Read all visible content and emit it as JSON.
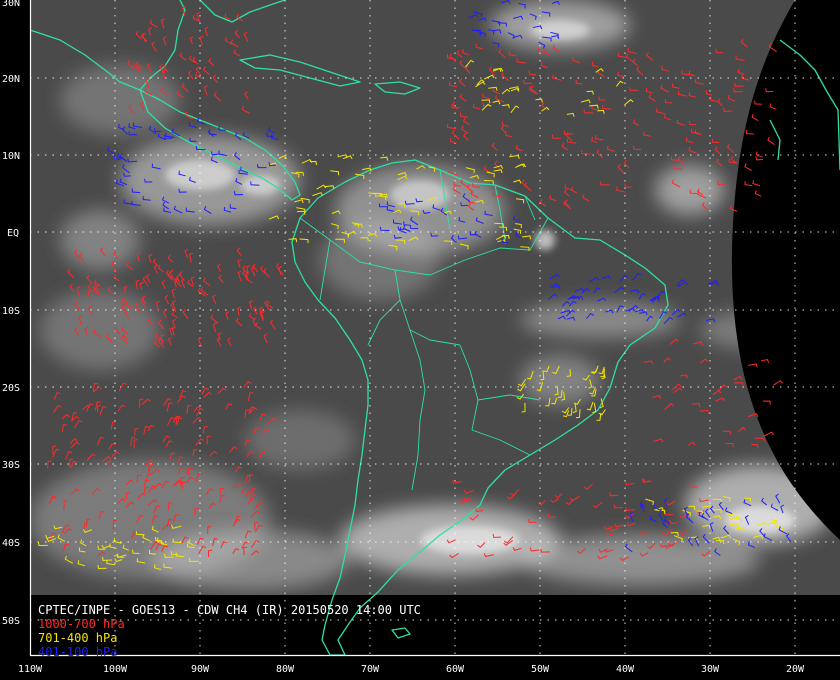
{
  "title": "CPTEC/INPE - GOES13 - CDW CH4 (IR) 20150520 14:00 UTC",
  "legend": [
    {
      "label": "1000-700 hPa",
      "color": "#ff2a2a"
    },
    {
      "label": "701-400 hPa",
      "color": "#f2e600"
    },
    {
      "label": "401-100 hPa",
      "color": "#1f1fff"
    }
  ],
  "latitude_labels": [
    "30N",
    "20N",
    "10N",
    "EQ",
    "10S",
    "20S",
    "30S",
    "40S",
    "50S"
  ],
  "longitude_labels": [
    "110W",
    "100W",
    "90W",
    "80W",
    "70W",
    "60W",
    "50W",
    "40W",
    "30W",
    "20W"
  ],
  "colors": {
    "background": "#000000",
    "coastline": "#2ee0a0",
    "grid": "#ffffff",
    "satellite_cloud": "#d8d8d8",
    "satellite_ground": "#4a4a4a"
  },
  "wind_vector_regions": [
    {
      "level": "1000-700 hPa",
      "lon_min": -105,
      "lon_max": -80,
      "lat_min": -15,
      "lat_max": -3,
      "count": 120
    },
    {
      "level": "1000-700 hPa",
      "lon_min": -108,
      "lon_max": -82,
      "lat_min": -42,
      "lat_max": -20,
      "count": 160
    },
    {
      "level": "1000-700 hPa",
      "lon_min": -60,
      "lon_max": -22,
      "lat_min": 2,
      "lat_max": 24,
      "count": 160
    },
    {
      "level": "1000-700 hPa",
      "lon_min": -98,
      "lon_max": -84,
      "lat_min": 14,
      "lat_max": 28,
      "count": 50
    },
    {
      "level": "1000-700 hPa",
      "lon_min": -60,
      "lon_max": -30,
      "lat_min": -42,
      "lat_max": -32,
      "count": 60
    },
    {
      "level": "1000-700 hPa",
      "lon_min": -38,
      "lon_max": -22,
      "lat_min": -28,
      "lat_max": -14,
      "count": 30
    },
    {
      "level": "701-400 hPa",
      "lon_min": -82,
      "lon_max": -52,
      "lat_min": -2,
      "lat_max": 10,
      "count": 70
    },
    {
      "level": "701-400 hPa",
      "lon_min": -52,
      "lon_max": -42,
      "lat_min": -24,
      "lat_max": -17,
      "count": 35
    },
    {
      "level": "701-400 hPa",
      "lon_min": -108,
      "lon_max": -90,
      "lat_min": -44,
      "lat_max": -38,
      "count": 40
    },
    {
      "level": "701-400 hPa",
      "lon_min": -38,
      "lon_max": -22,
      "lat_min": -40,
      "lat_max": -34,
      "count": 30
    },
    {
      "level": "701-400 hPa",
      "lon_min": -60,
      "lon_max": -40,
      "lat_min": 15,
      "lat_max": 22,
      "count": 25
    },
    {
      "level": "401-100 hPa",
      "lon_min": -100,
      "lon_max": -80,
      "lat_min": 2,
      "lat_max": 14,
      "count": 60
    },
    {
      "level": "401-100 hPa",
      "lon_min": -50,
      "lon_max": -30,
      "lat_min": -12,
      "lat_max": -6,
      "count": 45
    },
    {
      "level": "401-100 hPa",
      "lon_min": -40,
      "lon_max": -20,
      "lat_min": -42,
      "lat_max": -35,
      "count": 35
    },
    {
      "level": "401-100 hPa",
      "lon_min": -60,
      "lon_max": -48,
      "lat_min": 24,
      "lat_max": 30,
      "count": 25
    },
    {
      "level": "401-100 hPa",
      "lon_min": -68,
      "lon_max": -52,
      "lat_min": -2,
      "lat_max": 4,
      "count": 30
    }
  ]
}
